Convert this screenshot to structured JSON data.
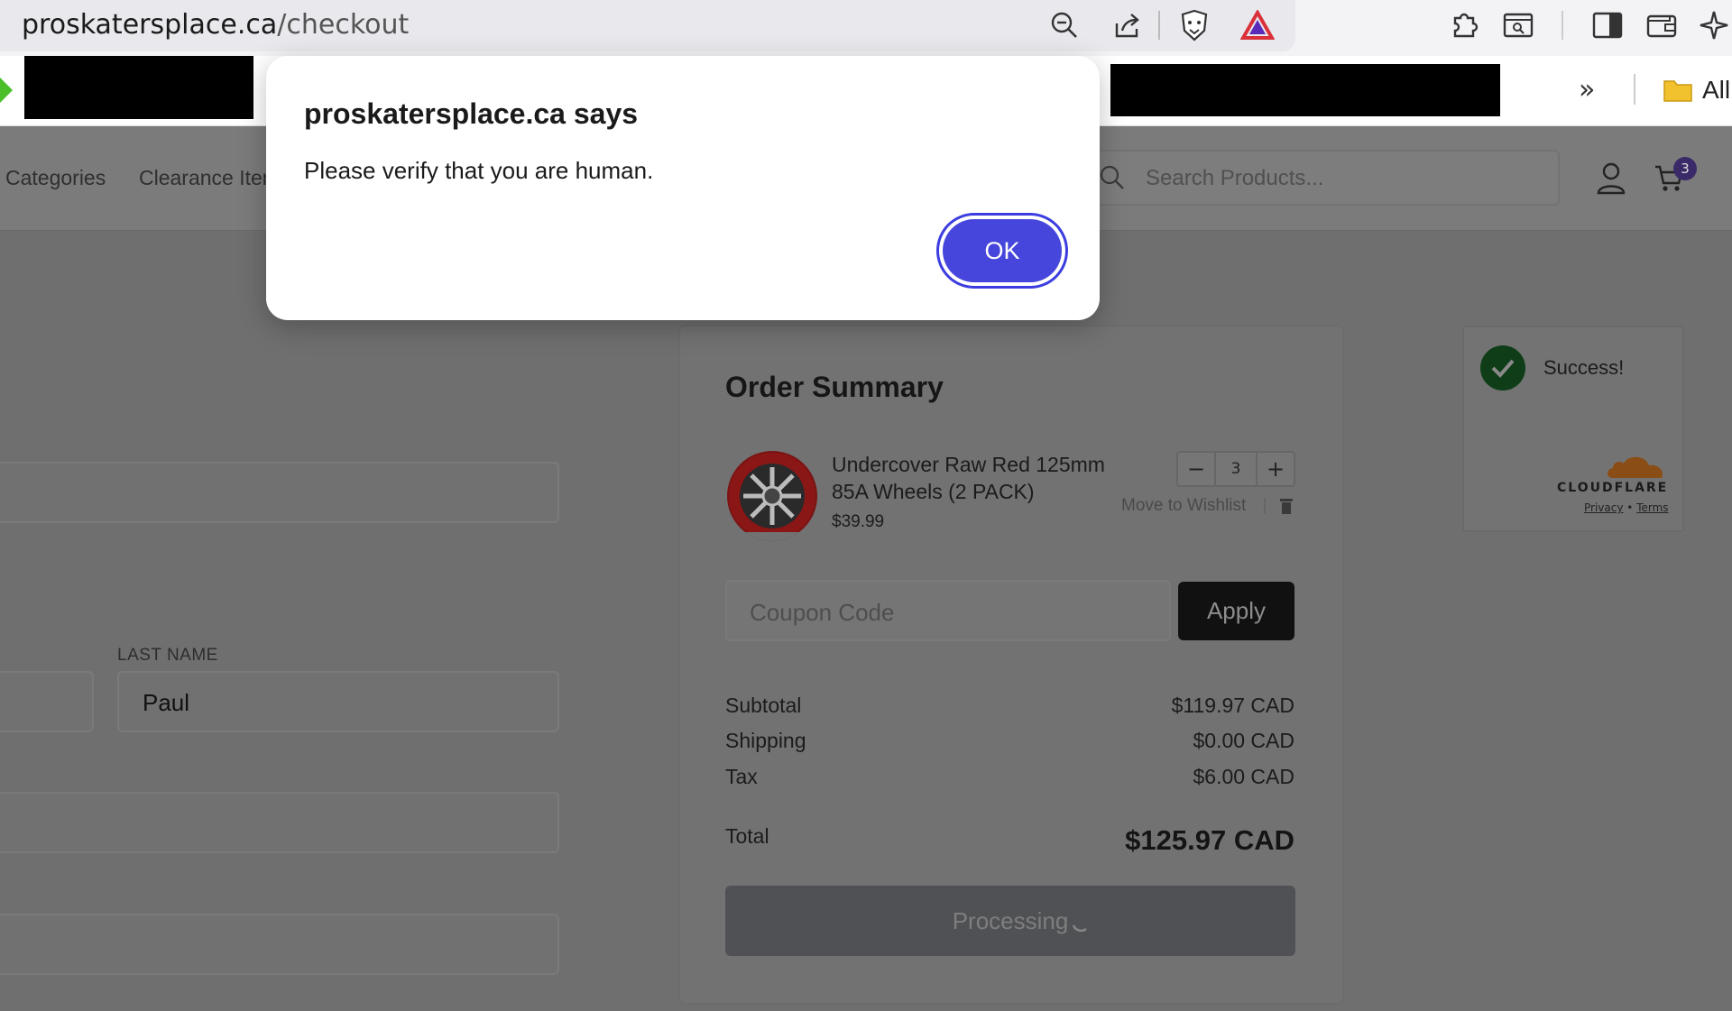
{
  "browser": {
    "url_domain": "proskatersplace.ca",
    "url_path": "/checkout",
    "bookmarks_all_label": "All"
  },
  "site": {
    "nav": [
      "Categories",
      "Clearance Iten"
    ],
    "search_placeholder": "Search Products...",
    "cart_count": "3"
  },
  "form": {
    "last_name_label": "LAST NAME",
    "last_name_value": "Paul"
  },
  "order_summary": {
    "title": "Order Summary",
    "item": {
      "name": "Undercover Raw Red 125mm 85A Wheels (2 PACK)",
      "price": "$39.99",
      "quantity": "3",
      "minus": "−",
      "plus": "+",
      "move_to_wishlist": "Move to Wishlist"
    },
    "coupon_placeholder": "Coupon Code",
    "apply_label": "Apply",
    "subtotal_label": "Subtotal",
    "subtotal_value": "$119.97 CAD",
    "shipping_label": "Shipping",
    "shipping_value": "$0.00 CAD",
    "tax_label": "Tax",
    "tax_value": "$6.00 CAD",
    "total_label": "Total",
    "total_value": "$125.97 CAD",
    "processing_label": "Processing"
  },
  "cloudflare": {
    "status": "Success!",
    "brand": "CLOUDFLARE",
    "privacy": "Privacy",
    "separator": "•",
    "terms": "Terms"
  },
  "dialog": {
    "title": "proskatersplace.ca says",
    "message": "Please verify that you are human.",
    "ok_label": "OK"
  },
  "colors": {
    "dialog_button": "#4646dc",
    "overlay": "#6f6f6f",
    "cf_check": "#0f3d18",
    "cart_badge": "#3b2a68"
  }
}
